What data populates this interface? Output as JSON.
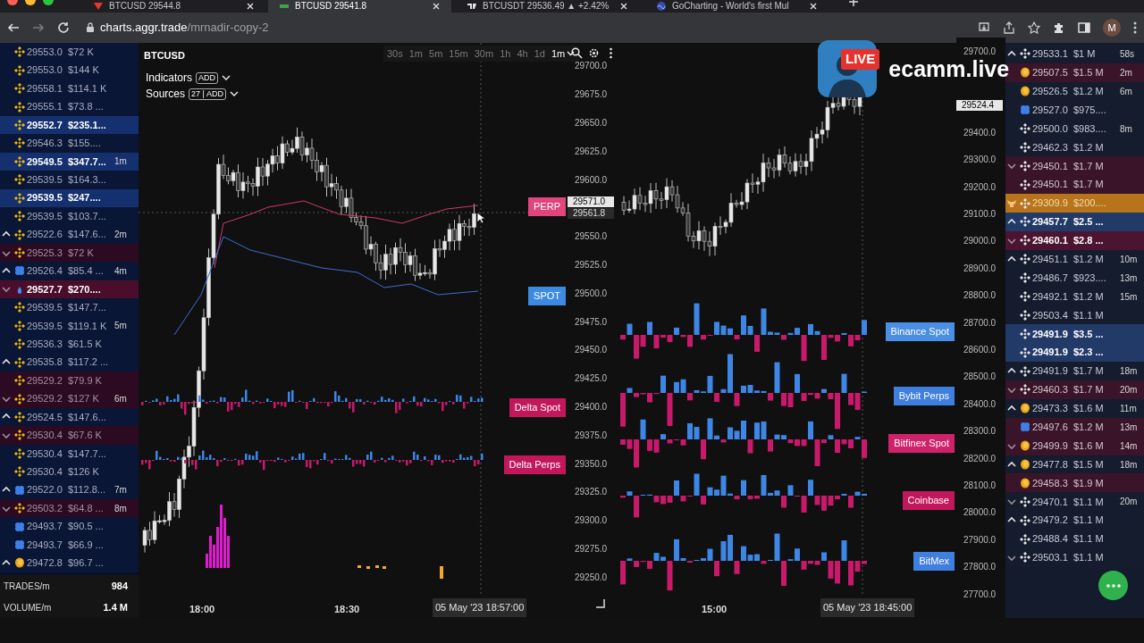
{
  "browser": {
    "tabs": [
      {
        "title": "BTCUSD 29544.8",
        "selected": false,
        "kind": "triangle"
      },
      {
        "title": "BTCUSD 29541.8",
        "selected": true,
        "kind": "bar"
      },
      {
        "title": "BTCUSDT 29536.49 ▲ +2.42%",
        "selected": false,
        "kind": "tv"
      },
      {
        "title": "GoCharting - World's first Mul",
        "selected": false,
        "kind": "wave"
      }
    ],
    "url_host": "charts.aggr.trade",
    "url_path": "/mrnadir-copy-2",
    "profile": "M"
  },
  "left_trades": {
    "rows": [
      {
        "kind": "binance",
        "up": false,
        "down": false,
        "liquidation": false,
        "sell": false,
        "large": false,
        "price": "29553.0",
        "amount": "$72 K"
      },
      {
        "kind": "binance",
        "up": false,
        "down": false,
        "liquidation": false,
        "sell": false,
        "large": false,
        "price": "29553.0",
        "amount": "$144 K"
      },
      {
        "kind": "binance",
        "up": false,
        "down": false,
        "liquidation": false,
        "sell": false,
        "large": false,
        "price": "29558.1",
        "amount": "$114.1 K"
      },
      {
        "kind": "binance",
        "up": false,
        "down": false,
        "liquidation": false,
        "sell": false,
        "large": false,
        "price": "29555.1",
        "amount": "$73.8 ..."
      },
      {
        "kind": "binance",
        "up": false,
        "down": false,
        "liquidation": false,
        "sell": false,
        "large": true,
        "price": "29552.7",
        "amount": "$235.1..."
      },
      {
        "kind": "binance",
        "up": false,
        "down": false,
        "liquidation": false,
        "sell": false,
        "large": false,
        "price": "29546.3",
        "amount": "$155...."
      },
      {
        "kind": "binance",
        "up": false,
        "down": false,
        "liquidation": false,
        "sell": false,
        "large": true,
        "price": "29549.5",
        "amount": "$347.7...",
        "age": "1m"
      },
      {
        "kind": "binance",
        "up": false,
        "down": false,
        "liquidation": false,
        "sell": false,
        "large": false,
        "price": "29539.5",
        "amount": "$164.3..."
      },
      {
        "kind": "binance",
        "up": false,
        "down": false,
        "liquidation": false,
        "sell": false,
        "large": true,
        "price": "29539.5",
        "amount": "$247...."
      },
      {
        "kind": "binance",
        "up": false,
        "down": false,
        "liquidation": false,
        "sell": false,
        "large": false,
        "price": "29539.5",
        "amount": "$103.7..."
      },
      {
        "kind": "binance",
        "up": true,
        "down": false,
        "liquidation": false,
        "sell": false,
        "large": false,
        "price": "29522.6",
        "amount": "$147.6...",
        "age": "2m"
      },
      {
        "kind": "binance",
        "up": false,
        "down": true,
        "liquidation": false,
        "sell": true,
        "large": false,
        "price": "29525.3",
        "amount": "$72 K"
      },
      {
        "kind": "flower",
        "up": true,
        "down": false,
        "liquidation": false,
        "sell": false,
        "large": false,
        "price": "29526.4",
        "amount": "$85.4 ...",
        "age": "4m"
      },
      {
        "kind": "drop",
        "up": false,
        "down": true,
        "liquidation": false,
        "sell": true,
        "large": true,
        "price": "29527.7",
        "amount": "$270...."
      },
      {
        "kind": "binance",
        "up": false,
        "down": false,
        "liquidation": false,
        "sell": false,
        "large": false,
        "price": "29539.5",
        "amount": "$147.7..."
      },
      {
        "kind": "binance",
        "up": false,
        "down": false,
        "liquidation": false,
        "sell": false,
        "large": false,
        "price": "29539.5",
        "amount": "$119.1 K",
        "age": "5m"
      },
      {
        "kind": "binance",
        "up": false,
        "down": false,
        "liquidation": false,
        "sell": false,
        "large": false,
        "price": "29536.3",
        "amount": "$61.5 K"
      },
      {
        "kind": "binance",
        "up": true,
        "down": false,
        "liquidation": false,
        "sell": false,
        "large": false,
        "price": "29535.8",
        "amount": "$117.2 ..."
      },
      {
        "kind": "binance",
        "up": false,
        "down": false,
        "liquidation": false,
        "sell": true,
        "large": false,
        "price": "29529.2",
        "amount": "$79.9 K"
      },
      {
        "kind": "binance",
        "up": false,
        "down": true,
        "liquidation": false,
        "sell": true,
        "large": false,
        "price": "29529.2",
        "amount": "$127 K",
        "age": "6m"
      },
      {
        "kind": "binance",
        "up": true,
        "down": false,
        "liquidation": false,
        "sell": false,
        "large": false,
        "price": "29524.5",
        "amount": "$147.6..."
      },
      {
        "kind": "binance",
        "up": false,
        "down": true,
        "liquidation": false,
        "sell": true,
        "large": false,
        "price": "29530.4",
        "amount": "$67.6 K"
      },
      {
        "kind": "binance",
        "up": false,
        "down": false,
        "liquidation": false,
        "sell": false,
        "large": false,
        "price": "29530.4",
        "amount": "$147.7..."
      },
      {
        "kind": "binance",
        "up": false,
        "down": false,
        "liquidation": false,
        "sell": false,
        "large": false,
        "price": "29530.4",
        "amount": "$126 K"
      },
      {
        "kind": "flower",
        "up": true,
        "down": false,
        "liquidation": false,
        "sell": false,
        "large": false,
        "price": "29522.0",
        "amount": "$112.8...",
        "age": "7m"
      },
      {
        "kind": "binance",
        "up": false,
        "down": true,
        "liquidation": false,
        "sell": true,
        "large": false,
        "price": "29503.2",
        "amount": "$64.8 ...",
        "age": "8m"
      },
      {
        "kind": "flower",
        "up": false,
        "down": false,
        "liquidation": false,
        "sell": false,
        "large": false,
        "price": "29493.7",
        "amount": "$90.5 ..."
      },
      {
        "kind": "flower",
        "up": false,
        "down": false,
        "liquidation": false,
        "sell": false,
        "large": false,
        "price": "29493.7",
        "amount": "$66.9 ..."
      },
      {
        "kind": "coin",
        "up": true,
        "down": false,
        "liquidation": false,
        "sell": false,
        "large": false,
        "price": "29472.8",
        "amount": "$96.7 ..."
      }
    ]
  },
  "stats": [
    {
      "label": "TRADES/m",
      "value": "984"
    },
    {
      "label": "VOLUME/m",
      "value": "1.4 M"
    }
  ],
  "chart_left": {
    "symbol": "BTCUSD",
    "timeframes": [
      {
        "label": "30s",
        "selected": false
      },
      {
        "label": "1m",
        "selected": false
      },
      {
        "label": "5m",
        "selected": false
      },
      {
        "label": "15m",
        "selected": false
      },
      {
        "label": "30m",
        "selected": false
      },
      {
        "label": "1h",
        "selected": false
      },
      {
        "label": "4h",
        "selected": false
      },
      {
        "label": "1d",
        "selected": false
      },
      {
        "label": "1m",
        "selected": true
      }
    ],
    "indicators": {
      "label": "Indicators",
      "badge": "ADD"
    },
    "sources": {
      "label": "Sources",
      "badge": "27 | ADD"
    },
    "series_labels": [
      {
        "text": "PERP",
        "color": "#e0457b"
      },
      {
        "text": "SPOT",
        "color": "#3d8be0"
      },
      {
        "text": "Delta Spot",
        "color": "#c2185b"
      },
      {
        "text": "Delta Perps",
        "color": "#c2185b"
      }
    ],
    "axis": {
      "upper": [
        "29700.0",
        "29675.0",
        "29650.0",
        "29625.0",
        "29600.0"
      ],
      "tags": [
        "29571.0",
        "29561.8"
      ],
      "lower": [
        "29550.0",
        "29525.0",
        "29500.0",
        "29475.0",
        "29450.0",
        "29425.0",
        "29400.0",
        "29375.0",
        "29350.0",
        "29325.0",
        "29300.0",
        "29275.0",
        "29250.0"
      ]
    },
    "time_labels": [
      "18:00",
      "18:30"
    ],
    "crosshair_time": "05 May '23 18:57:00"
  },
  "chart_right": {
    "series_labels": [
      {
        "text": "Binance Spot",
        "color": "#4a8fe3"
      },
      {
        "text": "Bybit Perps",
        "color": "#3f7fe0"
      },
      {
        "text": "Bitfinex Spot",
        "color": "#d0226a"
      },
      {
        "text": "Coinbase",
        "color": "#c2185b"
      },
      {
        "text": "BitMex",
        "color": "#3f7fe0"
      }
    ],
    "axis": {
      "upper": [
        "29700.0"
      ],
      "tags": [
        "29524.4"
      ],
      "lower": [
        "29400.0",
        "29300.0",
        "29200.0",
        "29100.0",
        "29000.0",
        "28900.0",
        "28800.0",
        "28700.0",
        "28600.0",
        "28500.0",
        "28400.0",
        "28300.0",
        "28200.0",
        "28100.0",
        "28000.0",
        "27900.0",
        "27800.0",
        "27700.0"
      ]
    },
    "time_labels": [
      "15:00"
    ],
    "crosshair_time": "05 May '23 18:45:00"
  },
  "right_trades": {
    "rows": [
      {
        "kind": "binance",
        "up": true,
        "down": false,
        "liquidation": false,
        "sell": false,
        "large": false,
        "price": "29533.1",
        "amount": "$1 M",
        "age": "58s"
      },
      {
        "kind": "coin",
        "up": false,
        "down": false,
        "liquidation": false,
        "sell": true,
        "large": false,
        "price": "29507.5",
        "amount": "$1.5 M",
        "age": "2m"
      },
      {
        "kind": "coin",
        "up": false,
        "down": false,
        "liquidation": false,
        "sell": false,
        "large": false,
        "price": "29526.5",
        "amount": "$1.2 M",
        "age": "6m"
      },
      {
        "kind": "flower",
        "up": false,
        "down": false,
        "liquidation": false,
        "sell": false,
        "large": false,
        "price": "29527.0",
        "amount": "$975...."
      },
      {
        "kind": "binance",
        "up": false,
        "down": false,
        "liquidation": false,
        "sell": false,
        "large": false,
        "price": "29500.0",
        "amount": "$983....",
        "age": "8m"
      },
      {
        "kind": "binance",
        "up": false,
        "down": false,
        "liquidation": false,
        "sell": false,
        "large": false,
        "price": "29462.3",
        "amount": "$1.2 M"
      },
      {
        "kind": "binance",
        "up": false,
        "down": true,
        "liquidation": false,
        "sell": true,
        "large": false,
        "price": "29450.1",
        "amount": "$1.7 M"
      },
      {
        "kind": "binance",
        "up": false,
        "down": false,
        "liquidation": false,
        "sell": true,
        "large": false,
        "price": "29450.1",
        "amount": "$1.7 M"
      },
      {
        "kind": "binance",
        "up": false,
        "down": false,
        "liquidation": true,
        "sell": false,
        "large": false,
        "price": "29309.9",
        "amount": "$200...."
      },
      {
        "kind": "binance",
        "up": true,
        "down": false,
        "liquidation": false,
        "sell": false,
        "large": true,
        "price": "29457.7",
        "amount": "$2.5 ..."
      },
      {
        "kind": "binance",
        "up": false,
        "down": true,
        "liquidation": false,
        "sell": true,
        "large": true,
        "price": "29460.1",
        "amount": "$2.8 ..."
      },
      {
        "kind": "binance",
        "up": true,
        "down": false,
        "liquidation": false,
        "sell": false,
        "large": false,
        "price": "29451.1",
        "amount": "$1.2 M",
        "age": "10m"
      },
      {
        "kind": "binance",
        "up": false,
        "down": false,
        "liquidation": false,
        "sell": false,
        "large": false,
        "price": "29486.7",
        "amount": "$923....",
        "age": "13m"
      },
      {
        "kind": "binance",
        "up": false,
        "down": false,
        "liquidation": false,
        "sell": false,
        "large": false,
        "price": "29492.1",
        "amount": "$1.2 M",
        "age": "15m"
      },
      {
        "kind": "binance",
        "up": false,
        "down": false,
        "liquidation": false,
        "sell": false,
        "large": false,
        "price": "29503.4",
        "amount": "$1.1 M"
      },
      {
        "kind": "binance",
        "up": false,
        "down": false,
        "liquidation": false,
        "sell": false,
        "large": true,
        "price": "29491.9",
        "amount": "$3.5 ..."
      },
      {
        "kind": "binance",
        "up": false,
        "down": false,
        "liquidation": false,
        "sell": false,
        "large": true,
        "price": "29491.9",
        "amount": "$2.3 ..."
      },
      {
        "kind": "binance",
        "up": true,
        "down": false,
        "liquidation": false,
        "sell": false,
        "large": false,
        "price": "29491.9",
        "amount": "$1.7 M",
        "age": "18m"
      },
      {
        "kind": "binance",
        "up": false,
        "down": true,
        "liquidation": false,
        "sell": true,
        "large": false,
        "price": "29460.3",
        "amount": "$1.7 M",
        "age": "20m"
      },
      {
        "kind": "coin",
        "up": true,
        "down": false,
        "liquidation": false,
        "sell": false,
        "large": false,
        "price": "29473.3",
        "amount": "$1.6 M",
        "age": "11m"
      },
      {
        "kind": "flower",
        "up": false,
        "down": false,
        "liquidation": false,
        "sell": true,
        "large": false,
        "price": "29497.6",
        "amount": "$1.2 M",
        "age": "13m"
      },
      {
        "kind": "coin",
        "up": false,
        "down": true,
        "liquidation": false,
        "sell": true,
        "large": false,
        "price": "29499.9",
        "amount": "$1.6 M",
        "age": "14m"
      },
      {
        "kind": "coin",
        "up": true,
        "down": false,
        "liquidation": false,
        "sell": false,
        "large": false,
        "price": "29477.8",
        "amount": "$1.5 M",
        "age": "18m"
      },
      {
        "kind": "coin",
        "up": false,
        "down": false,
        "liquidation": false,
        "sell": true,
        "large": false,
        "price": "29458.3",
        "amount": "$1.9 M"
      },
      {
        "kind": "binance",
        "up": false,
        "down": true,
        "liquidation": false,
        "sell": false,
        "large": false,
        "price": "29470.1",
        "amount": "$1.1 M",
        "age": "20m"
      },
      {
        "kind": "binance",
        "up": true,
        "down": false,
        "liquidation": false,
        "sell": false,
        "large": false,
        "price": "29479.2",
        "amount": "$1.1 M"
      },
      {
        "kind": "binance",
        "up": false,
        "down": false,
        "liquidation": false,
        "sell": false,
        "large": false,
        "price": "29488.4",
        "amount": "$1.1 M"
      },
      {
        "kind": "binance",
        "up": false,
        "down": true,
        "liquidation": false,
        "sell": false,
        "large": false,
        "price": "29503.1",
        "amount": "$1.1 M"
      }
    ]
  },
  "overlay": {
    "badge": "LIVE",
    "brand": "ecamm.live"
  }
}
